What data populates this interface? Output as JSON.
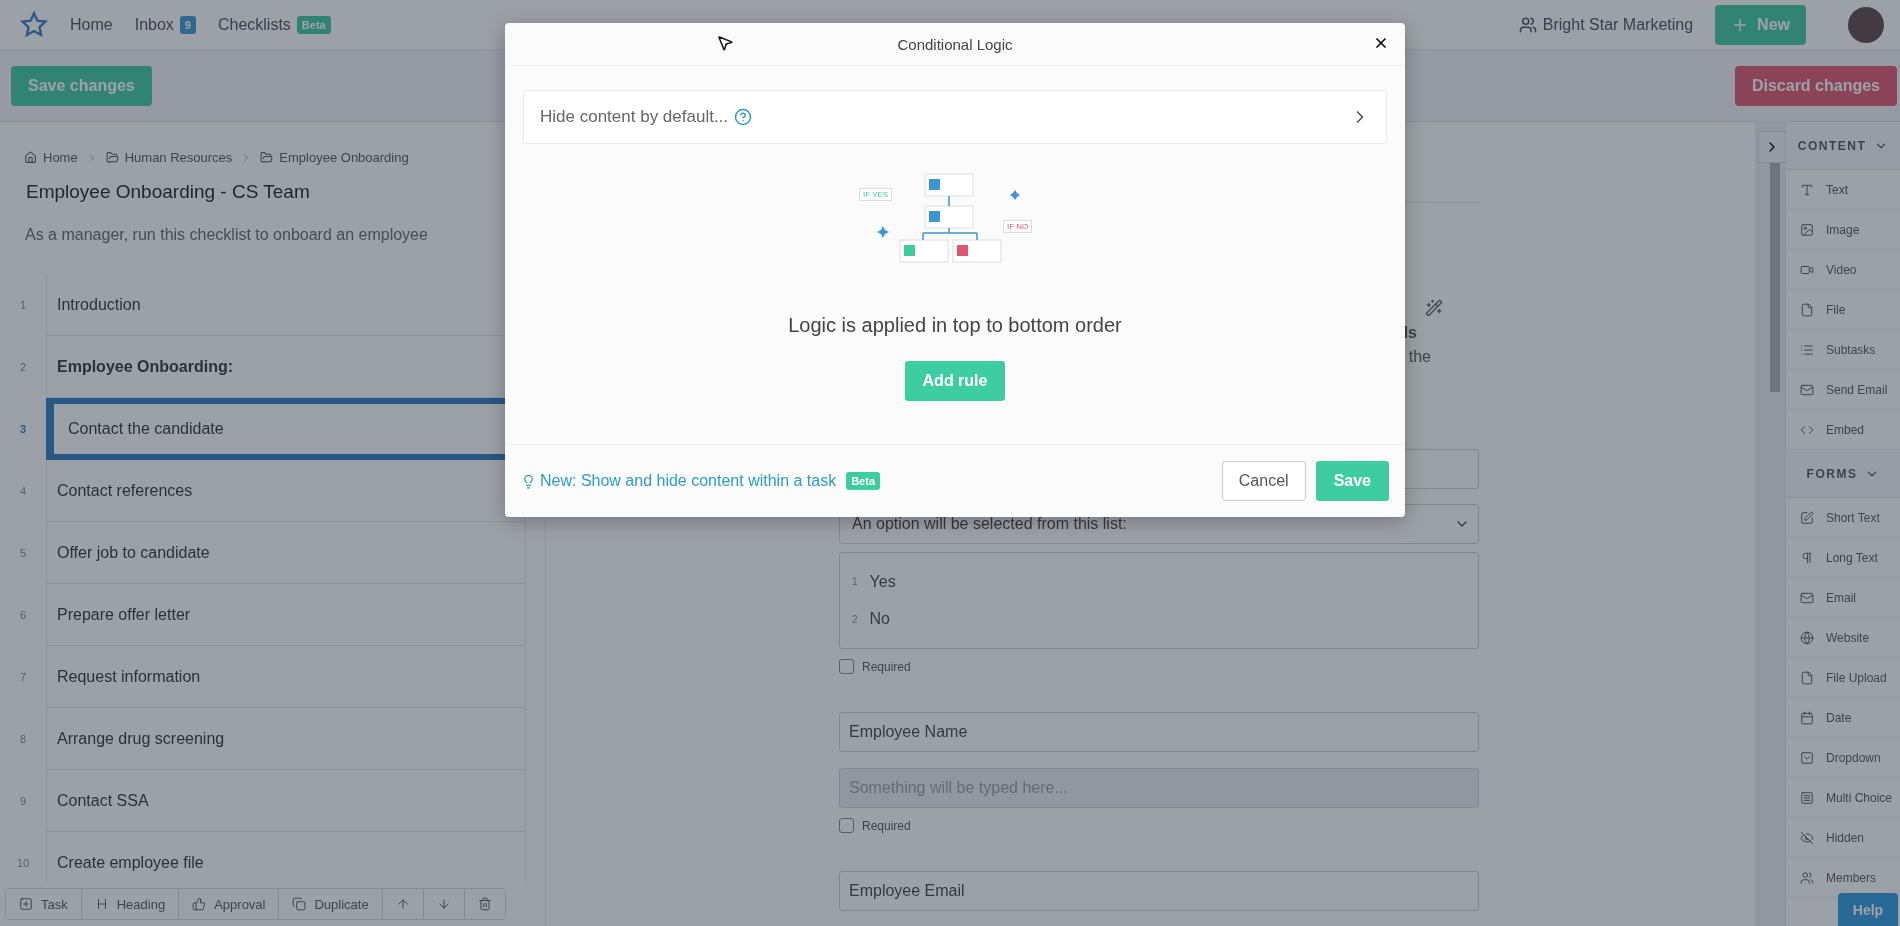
{
  "nav": {
    "links": [
      {
        "label": "Home"
      },
      {
        "label": "Inbox",
        "badge": "9",
        "kind": "count"
      },
      {
        "label": "Checklists",
        "badge": "Beta",
        "kind": "beta"
      }
    ],
    "org": "Bright Star Marketing",
    "new_button": "New"
  },
  "toolbar": {
    "save": "Save changes",
    "discard": "Discard changes"
  },
  "breadcrumbs": [
    {
      "label": "Home",
      "kind": "home"
    },
    {
      "label": "Human Resources",
      "kind": "folder"
    },
    {
      "label": "Employee Onboarding",
      "kind": "folder"
    }
  ],
  "checklist": {
    "title": "Employee Onboarding - CS Team",
    "description": "As a manager, run this checklist to onboard an employee",
    "tasks": [
      {
        "number": "1",
        "label": "Introduction",
        "kind": "task",
        "selected": false
      },
      {
        "number": "2",
        "label": "Employee Onboarding:",
        "kind": "heading",
        "selected": false
      },
      {
        "number": "3",
        "label": "Contact the candidate",
        "kind": "task",
        "selected": true
      },
      {
        "number": "4",
        "label": "Contact references",
        "kind": "task",
        "selected": false
      },
      {
        "number": "5",
        "label": "Offer job to candidate",
        "kind": "task",
        "selected": false
      },
      {
        "number": "6",
        "label": "Prepare offer letter",
        "kind": "task",
        "selected": false
      },
      {
        "number": "7",
        "label": "Request information",
        "kind": "task",
        "selected": false
      },
      {
        "number": "8",
        "label": "Arrange drug screening",
        "kind": "task",
        "selected": false
      },
      {
        "number": "9",
        "label": "Contact SSA",
        "kind": "task",
        "selected": false
      },
      {
        "number": "10",
        "label": "Create employee file",
        "kind": "task",
        "selected": false
      }
    ]
  },
  "task_actions": [
    {
      "label": "Task",
      "kind": "task"
    },
    {
      "label": "Heading",
      "kind": "heading"
    },
    {
      "label": "Approval",
      "kind": "approval"
    },
    {
      "label": "Duplicate",
      "kind": "duplicate"
    },
    {
      "kind": "up"
    },
    {
      "kind": "down"
    },
    {
      "kind": "delete"
    }
  ],
  "editor": {
    "text_fragments": [
      {
        "text": "ls",
        "bold": true
      },
      {
        "text": "the",
        "bold": false
      }
    ],
    "widgets": [
      {
        "kind": "dropdown",
        "value": "An option will be selected from this list:",
        "options": [
          {
            "number": "1",
            "label": "Yes"
          },
          {
            "number": "2",
            "label": "No"
          }
        ],
        "required_label": "Required",
        "required": false
      },
      {
        "kind": "short_text",
        "label": "Employee Name",
        "placeholder": "Something will be typed here...",
        "required_label": "Required",
        "required": false
      },
      {
        "kind": "short_text",
        "label": "Employee Email"
      }
    ]
  },
  "sidebar": {
    "sections": [
      {
        "title": "CONTENT",
        "expanded": true,
        "items": [
          {
            "label": "Text",
            "kind": "text"
          },
          {
            "label": "Image",
            "kind": "image"
          },
          {
            "label": "Video",
            "kind": "video"
          },
          {
            "label": "File",
            "kind": "file"
          },
          {
            "label": "Subtasks",
            "kind": "subtasks"
          },
          {
            "label": "Send Email",
            "kind": "email"
          },
          {
            "label": "Embed",
            "kind": "embed"
          }
        ]
      },
      {
        "title": "FORMS",
        "expanded": true,
        "items": [
          {
            "label": "Short Text",
            "kind": "short_text"
          },
          {
            "label": "Long Text",
            "kind": "long_text"
          },
          {
            "label": "Email",
            "kind": "email"
          },
          {
            "label": "Website",
            "kind": "website"
          },
          {
            "label": "File Upload",
            "kind": "file"
          },
          {
            "label": "Date",
            "kind": "date"
          },
          {
            "label": "Dropdown",
            "kind": "dropdown"
          },
          {
            "label": "Multi Choice",
            "kind": "multi_choice"
          },
          {
            "label": "Hidden",
            "kind": "hidden"
          },
          {
            "label": "Members",
            "kind": "members"
          }
        ]
      }
    ]
  },
  "help": "Help",
  "modal": {
    "title": "Conditional Logic",
    "default_row": "Hide content by default...",
    "tags": [
      "IF YES",
      "IF NO"
    ],
    "message": "Logic is applied in top to bottom order",
    "add_rule": "Add rule",
    "tip": "New: Show and hide content within a task",
    "tip_badge": "Beta",
    "cancel": "Cancel",
    "save": "Save"
  }
}
